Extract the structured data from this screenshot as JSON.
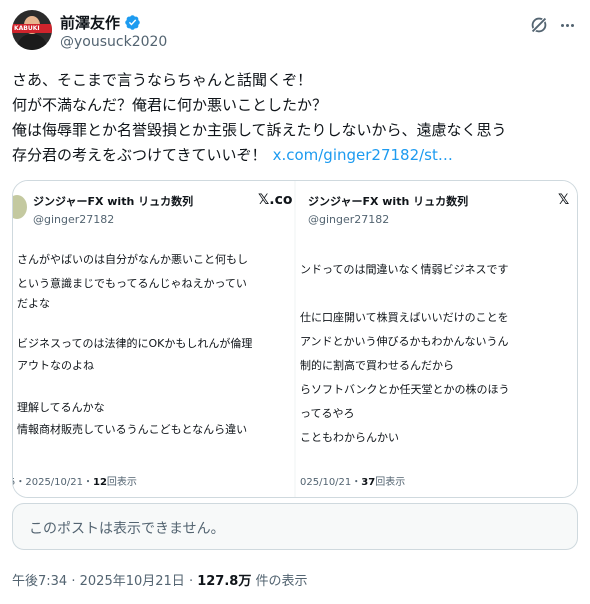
{
  "author": {
    "display_name": "前澤友作",
    "handle": "@yousuck2020",
    "avatar_label": "KABUKI"
  },
  "tweet": {
    "lines": [
      "さあ、そこまで言うならちゃんと話聞くぞ！",
      "何が不満なんだ？俺君に何か悪いことしたか？",
      "俺は侮辱罪とか名誉毀損とか主張して訴えたりしないから、遠慮なく思う",
      "存分君の考えをぶつけてきていいぞ！"
    ],
    "link_text": "x.com/ginger27182/st…"
  },
  "media": {
    "left": {
      "name": "ジンジャーFX with リュカ数列",
      "handle": "@ginger27182",
      "x_logo": "𝕏.co",
      "lines": [
        "さんがやばいのは自分がなんか悪いこと何もし",
        "という意識まじでもってるんじゃねえかってい",
        "だよな",
        "ビジネスってのは法律的にOKかもしれんが倫理",
        "アウトなのよね",
        "理解してるんかな",
        "情報商材販売しているうんこどもとなんら違い"
      ],
      "date": "5・2025/10/21・",
      "views": "12",
      "views_label": "回表示"
    },
    "right": {
      "name": "ジンジャーFX with リュカ数列",
      "handle": "@ginger27182",
      "x_logo": "𝕏",
      "lines": [
        "ンドってのは間違いなく情弱ビジネスです",
        "仕に口座開いて株買えばいいだけのことを",
        "アンドとかいう伸びるかもわかんないうん",
        "制的に割高で買わせるんだから",
        "らソフトバンクとか任天堂とかの株のほう",
        "ってるやろ",
        "こともわからんかい"
      ],
      "date": "025/10/21・",
      "views": "37",
      "views_label": "回表示"
    }
  },
  "quote": {
    "unavailable_text": "このポストは表示できません。"
  },
  "meta": {
    "time": "午後7:34",
    "sep": "·",
    "date": "2025年10月21日",
    "views": "127.8万",
    "views_label": "件の表示"
  },
  "colors": {
    "verified": "#1d9bf0",
    "link": "#1d9bf0",
    "secondary": "#536471"
  },
  "icons": {
    "verified": "verified-badge-icon",
    "grok": "grok-icon",
    "more": "more-icon"
  }
}
